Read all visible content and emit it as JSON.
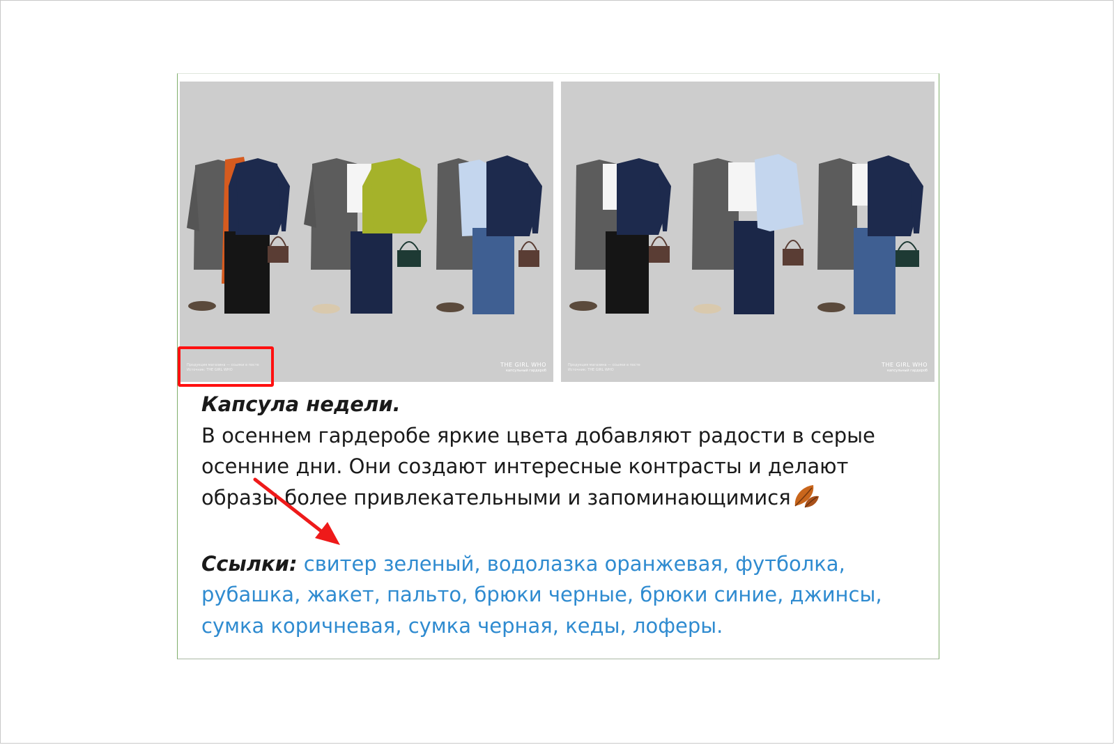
{
  "images": [
    {
      "fine_print": [
        "Продукция магазина — ссылки в посте",
        "Источник: THE GIRL WHO"
      ],
      "brand": "THE GIRL WHO",
      "brand_sub": "капсульный гардероб"
    },
    {
      "fine_print": [
        "Продукция магазина — ссылки в посте",
        "Источник: THE GIRL WHO"
      ],
      "brand": "THE GIRL WHO",
      "brand_sub": "капсульный гардероб"
    }
  ],
  "post": {
    "heading": "Капсула недели.",
    "body_lines": [
      "В осеннем гардеробе яркие цвета добавляют радости в серые",
      "осенние дни. Они создают интересные контрасты и делают",
      "образы более привлекательными и запоминающимися"
    ],
    "emoji_icon": "fallen-leaf-icon",
    "links_label": "Ссылки:",
    "links": [
      {
        "text": "свитер зеленый",
        "sep": ", "
      },
      {
        "text": "водолазка оранжевая",
        "sep": ", "
      },
      {
        "text": "футболка",
        "sep": ","
      },
      {
        "text": "рубашка",
        "sep": ", "
      },
      {
        "text": "жакет",
        "sep": ", "
      },
      {
        "text": "пальто",
        "sep": ", "
      },
      {
        "text": "брюки черные",
        "sep": ", "
      },
      {
        "text": "брюки синие",
        "sep": ", "
      },
      {
        "text": "джинсы",
        "sep": ","
      },
      {
        "text": "сумка коричневая",
        "sep": ", "
      },
      {
        "text": "сумка черная",
        "sep": ", "
      },
      {
        "text": "кеды",
        "sep": ", "
      },
      {
        "text": "лоферы",
        "sep": "."
      }
    ]
  },
  "annotations": {
    "highlight_box_color": "#ff1010",
    "arrow_color": "#ee1a1a"
  },
  "colors": {
    "link": "#2f8bd0",
    "text": "#1a1a1a",
    "photo_bg": "#cdcdcd"
  }
}
